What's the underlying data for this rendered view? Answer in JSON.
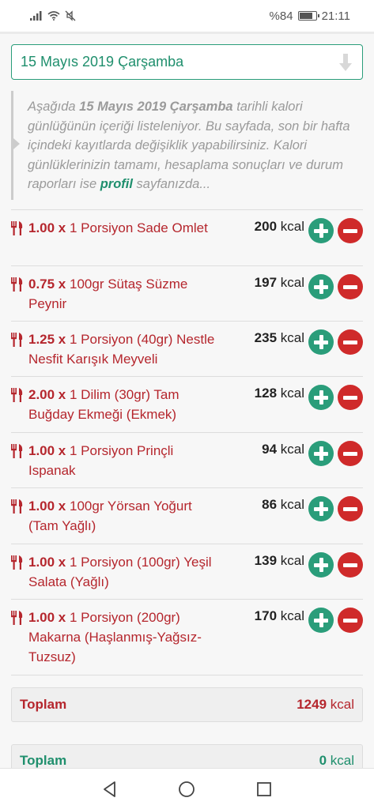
{
  "status_bar": {
    "battery_text": "%84",
    "battery_level": 0.84,
    "time": "21:11",
    "icons": [
      "signal-icon",
      "wifi-icon",
      "mute-icon",
      "battery-icon"
    ]
  },
  "date_select": {
    "value": "15 Mayıs 2019 Çarşamba",
    "icon": "arrow-down-icon"
  },
  "info": {
    "part1": "Aşağıda ",
    "date": "15 Mayıs 2019 Çarşamba",
    "part2": " tarihli kalori günlüğünün içeriği listeleniyor. Bu sayfada, son bir hafta içindeki kayıtlarda değişiklik yapabilirsiniz. Kalori günlüklerinizin tamamı, hesaplama sonuçları ve durum raporları ise ",
    "link": "profil",
    "part3": " sayfanızda..."
  },
  "entries": [
    {
      "qty": "1.00 x",
      "name": "1 Porsiyon Sade Omlet",
      "kcal": "200",
      "unit": "kcal"
    },
    {
      "qty": "0.75 x",
      "name": "100gr Sütaş Süzme Peynir",
      "kcal": "197",
      "unit": "kcal"
    },
    {
      "qty": "1.25 x",
      "name": "1 Porsiyon (40gr) Nestle Nesfit Karışık Meyveli",
      "kcal": "235",
      "unit": "kcal"
    },
    {
      "qty": "2.00 x",
      "name": "1 Dilim (30gr) Tam Buğday Ekmeği (Ekmek)",
      "kcal": "128",
      "unit": "kcal"
    },
    {
      "qty": "1.00 x",
      "name": "1 Porsiyon Prinçli Ispanak",
      "kcal": "94",
      "unit": "kcal"
    },
    {
      "qty": "1.00 x",
      "name": "100gr Yörsan Yoğurt (Tam Yağlı)",
      "kcal": "86",
      "unit": "kcal"
    },
    {
      "qty": "1.00 x",
      "name": "1 Porsiyon (100gr) Yeşil Salata (Yağlı)",
      "kcal": "139",
      "unit": "kcal"
    },
    {
      "qty": "1.00 x",
      "name": "1 Porsiyon (200gr) Makarna (Haşlanmış-Yağsız-Tuzsuz)",
      "kcal": "170",
      "unit": "kcal"
    }
  ],
  "total_consumed": {
    "label": "Toplam",
    "value": "1249",
    "unit": "kcal"
  },
  "total_burned": {
    "label": "Toplam",
    "value": "0",
    "unit": "kcal"
  },
  "colors": {
    "accent_green": "#2a9d7a",
    "accent_red": "#cf2a2a",
    "text_red": "#b5262d"
  },
  "navbar": {
    "icons": [
      "back-icon",
      "home-icon",
      "recents-icon"
    ]
  }
}
